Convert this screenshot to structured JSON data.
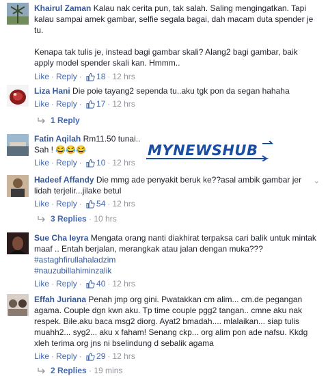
{
  "actions": {
    "like": "Like",
    "reply": "Reply"
  },
  "comments": [
    {
      "author": "Khairul Zaman",
      "lines": [
        "Kalau nak cerita pun, tak salah. Saling mengingatkan. Tapi",
        "kalau sampai amek gambar, selfie segala bagai, dah macam duta spender je",
        "tu.",
        "",
        "Kenapa tak tulis je, instead bagi gambar skali? Alang2 bagi gambar, baik",
        "apply model spender skali kan. Hmmm.."
      ],
      "likes": "18",
      "time": "12 hrs"
    },
    {
      "author": "Liza Hani",
      "lines": [
        "Die poie tayang2 sependa tu..aku tgk pon da segan hahaha"
      ],
      "likes": "17",
      "time": "12 hrs",
      "replies": "1 Reply"
    },
    {
      "author": "Fatin Aqilah",
      "lines": [
        "Rm11.50 tunai..",
        "Sah ! 😂😂😂"
      ],
      "likes": "10",
      "time": "12 hrs"
    },
    {
      "author": "Hadeef Affandy",
      "lines": [
        "Die mmg ade penyakit beruk ke??asal ambik gambar jer",
        "lidah terjelir...jilake betul"
      ],
      "likes": "54",
      "time": "12 hrs",
      "replies": "3 Replies",
      "replies_time": "10 hrs"
    },
    {
      "author": "Sue Cha Ieyra",
      "lines": [
        "Mengata orang nanti diakhirat terpaksa cari balik untuk mintak",
        "maaf .. Entah berjalan, merangkak atau jalan dengan muka???"
      ],
      "hashtags": [
        "#astaghfirullahaladzim",
        "#nauzubillahiminzalik"
      ],
      "likes": "40",
      "time": "12 hrs"
    },
    {
      "author": "Effah Juriana",
      "lines": [
        "Penah jmp org gini. Pwatakkan cm alim... cm.de pegangan",
        "agama. Couple dgn kwn aku. Tp time couple pgg2 tangan.. cmne aku nak",
        "respek. Bile.aku baca msg2 diorg. Ayat2 bmadah.... mlalaikan... siap tulis",
        "muahh2... syg2... aku x faham! Senang ckp... org alim pon ade nafsu. Kkdg",
        "xleh terima org jns ni bselindung d sebalik agama"
      ],
      "likes": "29",
      "time": "12 hrs",
      "replies": "2 Replies",
      "replies_time": "19 mins"
    }
  ],
  "watermark": "MYNEWSHUB",
  "colors": {
    "name": "#365899",
    "link": "#4267b2",
    "meta": "#90949c",
    "text": "#1d2129",
    "watermark": "#1b4ea3"
  },
  "icons": {
    "like": "thumbs-up-icon",
    "reply": "reply-arrow-icon",
    "menu": "chevron-down-icon"
  }
}
